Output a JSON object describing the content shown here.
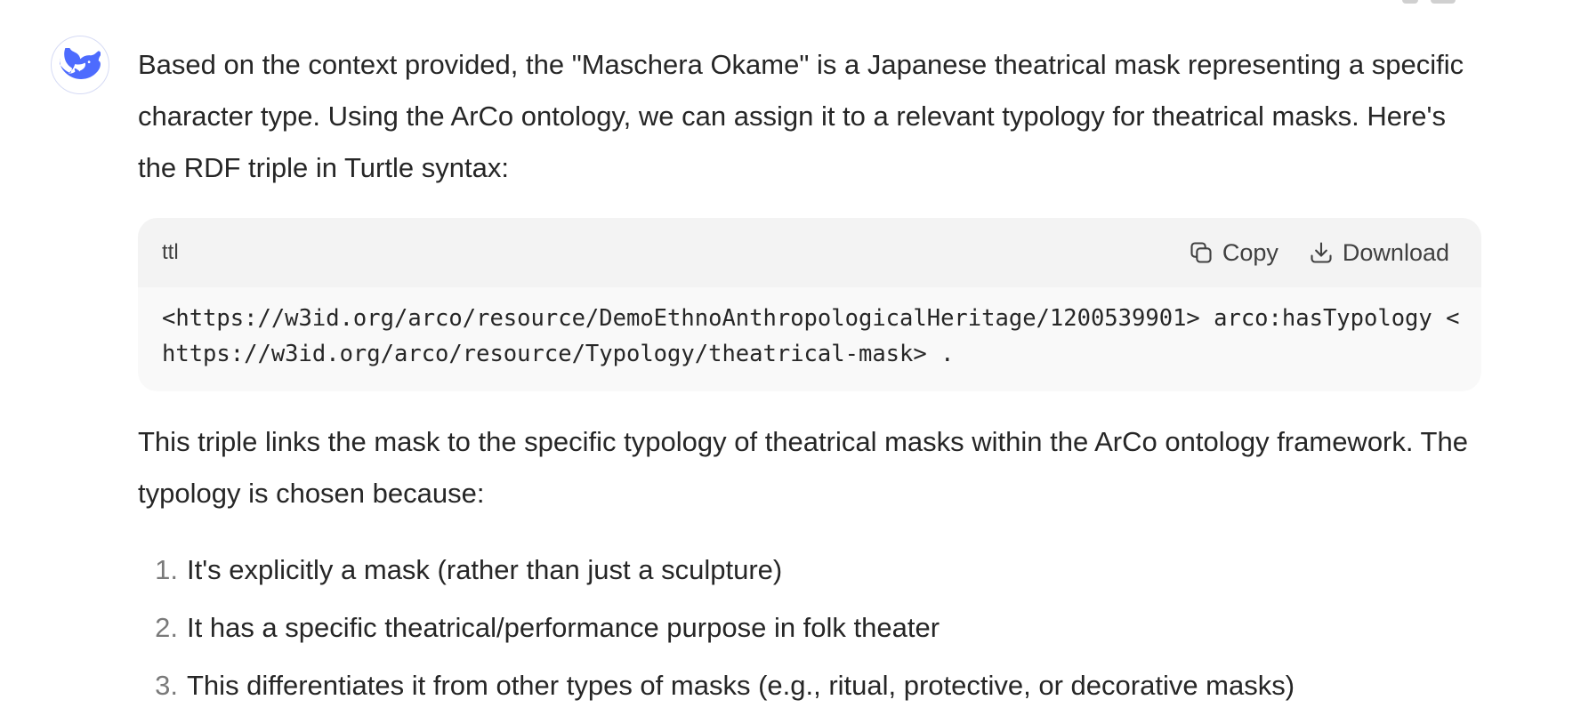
{
  "message": {
    "intro": "Based on the context provided, the \"Maschera Okame\" is a Japanese theatrical mask representing a specific character type. Using the ArCo ontology, we can assign it to a relevant typology for theatrical masks. Here's the RDF triple in Turtle syntax:",
    "code_block": {
      "language": "ttl",
      "copy_label": "Copy",
      "download_label": "Download",
      "line1": "<https://w3id.org/arco/resource/DemoEthnoAnthropologicalHeritage/1200539901> arco:hasTypology <",
      "line2": "https://w3id.org/arco/resource/Typology/theatrical-mask> ."
    },
    "explanation": "This triple links the mask to the specific typology of theatrical masks within the ArCo ontology framework. The typology is chosen because:",
    "reasons": [
      {
        "number": "1.",
        "text": "It's explicitly a mask (rather than just a sculpture)"
      },
      {
        "number": "2.",
        "text": "It has a specific theatrical/performance purpose in folk theater"
      },
      {
        "number": "3.",
        "text": "This differentiates it from other types of masks (e.g., ritual, protective, or decorative masks)"
      }
    ]
  },
  "icons": {
    "avatar": "whale-logo-icon",
    "copy": "copy-icon",
    "download": "download-icon"
  },
  "colors": {
    "brand": "#4d6bfe",
    "text": "#262626",
    "code_bg": "#f9f9f9",
    "code_header_bg": "#f3f3f3"
  }
}
